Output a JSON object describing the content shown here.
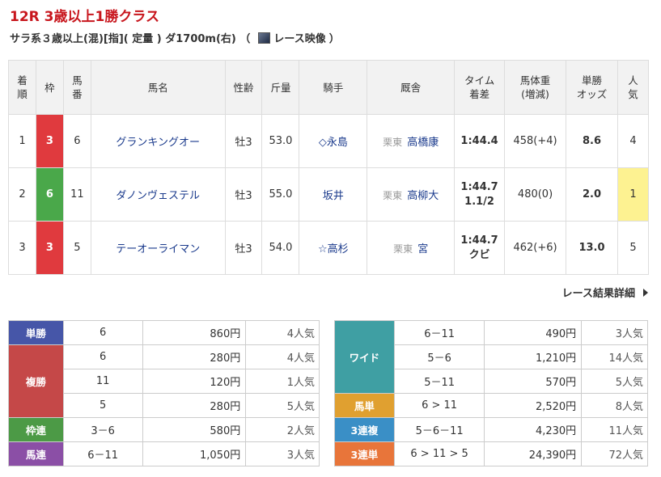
{
  "race": {
    "title": "12R 3歳以上1勝クラス",
    "conditions": "サラ系３歳以上(混)[指]( 定量 ) ダ1700m(右)  （",
    "video_link": "レース映像",
    "conditions_close": "）"
  },
  "result_table": {
    "headers": {
      "rank": [
        "着",
        "順"
      ],
      "waku": "枠",
      "umaban": [
        "馬",
        "番"
      ],
      "name": "馬名",
      "sexage": "性齢",
      "weight": "斤量",
      "jockey": "騎手",
      "trainer": "厩舎",
      "time": [
        "タイム",
        "着差"
      ],
      "body_weight": [
        "馬体重",
        "(増減)"
      ],
      "odds": [
        "単勝",
        "オッズ"
      ],
      "pop": [
        "人",
        "気"
      ]
    },
    "rows": [
      {
        "rank": "1",
        "waku": "3",
        "waku_color": "#e03a3e",
        "umaban": "6",
        "name": "グランキングオー",
        "sexage": "牡3",
        "weight": "53.0",
        "jockey": "◇永島",
        "region": "栗東",
        "trainer": "高橋康",
        "time": "1:44.4",
        "margin": "",
        "body_weight": "458(+4)",
        "odds": "8.6",
        "pop": "4",
        "pop_highlight": false
      },
      {
        "rank": "2",
        "waku": "6",
        "waku_color": "#4aa84a",
        "umaban": "11",
        "name": "ダノンヴェステル",
        "sexage": "牡3",
        "weight": "55.0",
        "jockey": "坂井",
        "region": "栗東",
        "trainer": "高柳大",
        "time": "1:44.7",
        "margin": "1.1/2",
        "body_weight": "480(0)",
        "odds": "2.0",
        "pop": "1",
        "pop_highlight": true
      },
      {
        "rank": "3",
        "waku": "3",
        "waku_color": "#e03a3e",
        "umaban": "5",
        "name": "テーオーライマン",
        "sexage": "牡3",
        "weight": "54.0",
        "jockey": "☆高杉",
        "region": "栗東",
        "trainer": "宮",
        "time": "1:44.7",
        "margin": "クビ",
        "body_weight": "462(+6)",
        "odds": "13.0",
        "pop": "5",
        "pop_highlight": false
      }
    ]
  },
  "detail_link": "レース結果詳細",
  "payouts_left": [
    {
      "type": "単勝",
      "color": "#4656a8",
      "rows": [
        {
          "combo": "6",
          "amount": "860円",
          "pop": "4人気"
        }
      ]
    },
    {
      "type": "複勝",
      "color": "#c54848",
      "rows": [
        {
          "combo": "6",
          "amount": "280円",
          "pop": "4人気"
        },
        {
          "combo": "11",
          "amount": "120円",
          "pop": "1人気"
        },
        {
          "combo": "5",
          "amount": "280円",
          "pop": "5人気"
        }
      ]
    },
    {
      "type": "枠連",
      "color": "#4c9a46",
      "rows": [
        {
          "combo": "3－6",
          "amount": "580円",
          "pop": "2人気"
        }
      ]
    },
    {
      "type": "馬連",
      "color": "#8b4fa6",
      "rows": [
        {
          "combo": "6－11",
          "amount": "1,050円",
          "pop": "3人気"
        }
      ]
    }
  ],
  "payouts_right": [
    {
      "type": "ワイド",
      "color": "#3f9fa3",
      "rows": [
        {
          "combo": "6－11",
          "amount": "490円",
          "pop": "3人気"
        },
        {
          "combo": "5－6",
          "amount": "1,210円",
          "pop": "14人気"
        },
        {
          "combo": "5－11",
          "amount": "570円",
          "pop": "5人気"
        }
      ]
    },
    {
      "type": "馬単",
      "color": "#e0a030",
      "rows": [
        {
          "combo": "6 > 11",
          "amount": "2,520円",
          "pop": "8人気"
        }
      ]
    },
    {
      "type": "3連複",
      "color": "#3a8fc6",
      "rows": [
        {
          "combo": "5－6－11",
          "amount": "4,230円",
          "pop": "11人気"
        }
      ]
    },
    {
      "type": "3連単",
      "color": "#e8753a",
      "rows": [
        {
          "combo": "6 > 11 > 5",
          "amount": "24,390円",
          "pop": "72人気"
        }
      ]
    }
  ]
}
